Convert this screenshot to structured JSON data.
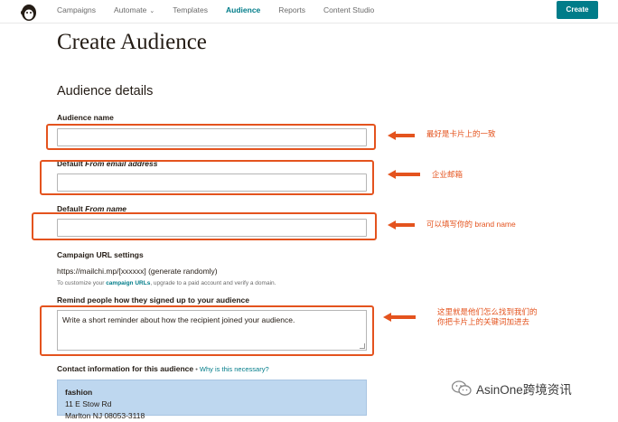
{
  "nav": {
    "items": [
      "Campaigns",
      "Automate",
      "Templates",
      "Audience",
      "Reports",
      "Content Studio"
    ],
    "active": "Audience",
    "create_label": "Create"
  },
  "page": {
    "title": "Create Audience",
    "section_title": "Audience details"
  },
  "form": {
    "audience_name_label": "Audience name",
    "audience_name_value": "",
    "from_email_prefix": "Default ",
    "from_email_italic": "From email address",
    "from_email_value": "",
    "from_name_prefix": "Default ",
    "from_name_italic": "From name",
    "from_name_value": "",
    "url_settings_label": "Campaign URL settings",
    "url_value": "https://mailchi.mp/[xxxxxx] (generate randomly)",
    "url_help_pre": "To customize your ",
    "url_help_link": "campaign URLs",
    "url_help_post": ", upgrade to a paid account and verify a domain.",
    "remind_label": "Remind people how they signed up to your audience",
    "remind_value": "Write a short reminder about how the recipient joined your audience.",
    "contact_label": "Contact information for this audience",
    "contact_sep": " • ",
    "contact_why": "Why is this necessary?",
    "contact_lines": [
      "fashion",
      "11 E Stow Rd",
      "Marlton NJ 08053-3118"
    ]
  },
  "annotations": {
    "note1": "最好是卡片上的一致",
    "note2": "企业邮箱",
    "note3": "可以填写你的 brand name",
    "note4_line1": "这里就是他们怎么找到我们的",
    "note4_line2": "你把卡片上的关键词加进去",
    "color": "#e4531e"
  },
  "watermark": {
    "text": "AsinOne跨境资讯"
  },
  "colors": {
    "brand": "#007c89",
    "contact_bg": "#bed7ef"
  }
}
